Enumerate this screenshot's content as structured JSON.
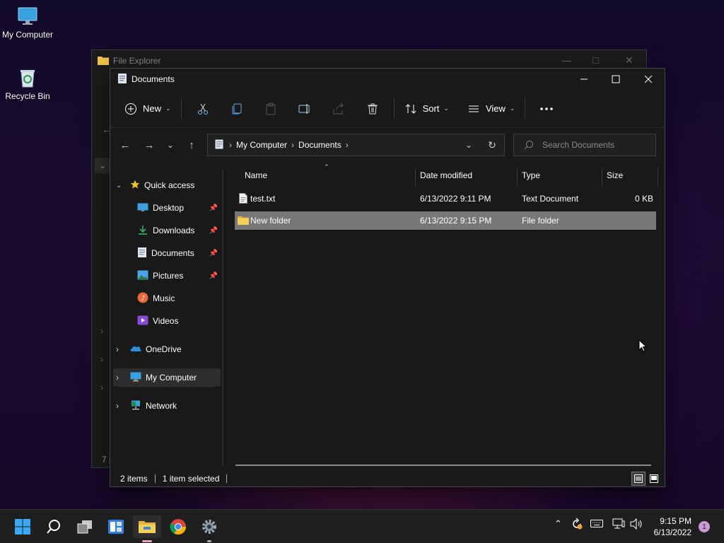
{
  "desktop": {
    "icons": [
      {
        "label": "My Computer"
      },
      {
        "label": "Recycle Bin"
      }
    ]
  },
  "back_window": {
    "title": "File Explorer",
    "status_fragment": "7 i"
  },
  "window": {
    "title": "Documents",
    "toolbar": {
      "new_label": "New",
      "sort_label": "Sort",
      "view_label": "View"
    },
    "address": {
      "crumbs": [
        "My Computer",
        "Documents"
      ]
    },
    "search": {
      "placeholder": "Search Documents"
    },
    "sidebar": {
      "quick_access": "Quick access",
      "items": [
        {
          "label": "Desktop"
        },
        {
          "label": "Downloads"
        },
        {
          "label": "Documents"
        },
        {
          "label": "Pictures"
        },
        {
          "label": "Music"
        },
        {
          "label": "Videos"
        }
      ],
      "onedrive": "OneDrive",
      "my_computer": "My Computer",
      "network": "Network"
    },
    "columns": {
      "name": "Name",
      "date": "Date modified",
      "type": "Type",
      "size": "Size"
    },
    "files": [
      {
        "name": "test.txt",
        "date": "6/13/2022 9:11 PM",
        "type": "Text Document",
        "size": "0 KB"
      },
      {
        "name": "New folder",
        "date": "6/13/2022 9:15 PM",
        "type": "File folder",
        "size": ""
      }
    ],
    "status": {
      "items": "2 items",
      "selected": "1 item selected"
    }
  },
  "taskbar": {
    "time": "9:15 PM",
    "date": "6/13/2022",
    "notification_count": "1"
  },
  "colors": {
    "accent": "#0078d4",
    "folder": "#f2c14e",
    "selection": "#777777",
    "window_bg": "#191919"
  }
}
